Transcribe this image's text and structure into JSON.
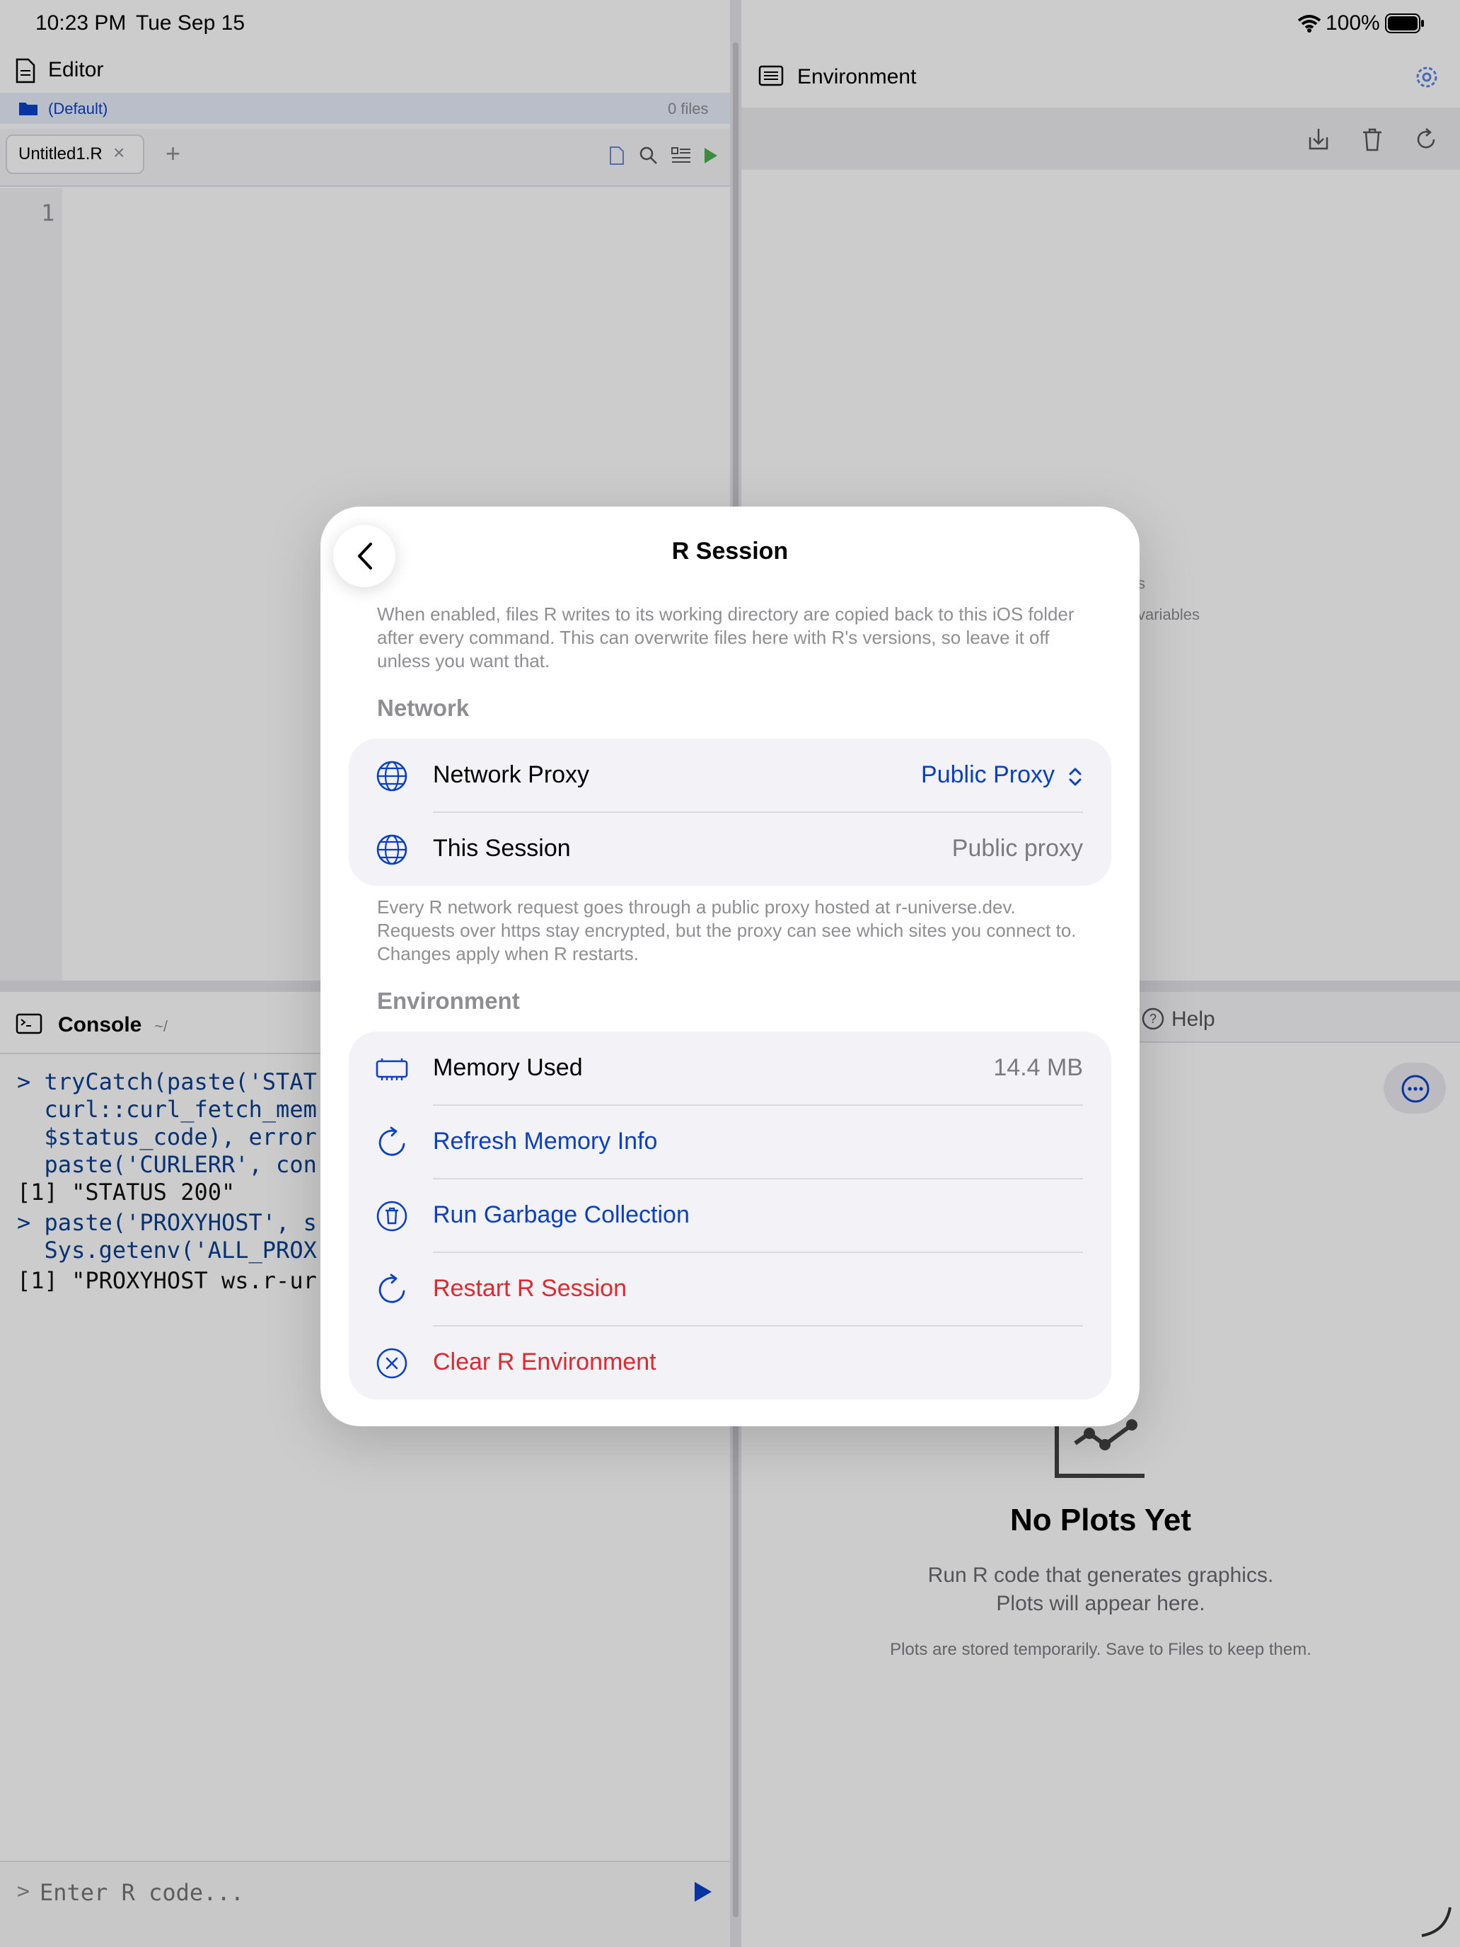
{
  "status_bar": {
    "time": "10:23 PM",
    "date": "Tue Sep 15",
    "battery": "100%"
  },
  "editor": {
    "title": "Editor",
    "folder": "(Default)",
    "file_count": "0 files",
    "tab": "Untitled1.R",
    "line_number": "1"
  },
  "environment": {
    "title": "Environment",
    "empty_partial_1": "s",
    "empty_partial_2": "variables"
  },
  "console": {
    "title": "Console",
    "path": "~/",
    "lines": [
      "> tryCatch(paste('STAT",
      "  curl::curl_fetch_mem",
      "  $status_code), error",
      "  paste('CURLERR', con",
      "[1] \"STATUS 200\"",
      "> paste('PROXYHOST', s",
      "  Sys.getenv('ALL_PROX",
      "[1] \"PROXYHOST ws.r-ur"
    ],
    "input_prompt": ">",
    "input_placeholder": "Enter R code..."
  },
  "help": {
    "title": "Help"
  },
  "plots": {
    "empty_title": "No Plots Yet",
    "empty_line1": "Run R code that generates graphics.",
    "empty_line2": "Plots will appear here.",
    "empty_note": "Plots are stored temporarily. Save to Files to keep them."
  },
  "modal": {
    "title": "R Session",
    "sync_footnote": "When enabled, files R writes to its working directory are copied back to this iOS folder after every command. This can overwrite files here with R's versions, so leave it off unless you want that.",
    "network_header": "Network",
    "network_proxy_label": "Network Proxy",
    "network_proxy_value": "Public Proxy",
    "this_session_label": "This Session",
    "this_session_value": "Public proxy",
    "network_footnote": "Every R network request goes through a public proxy hosted at r-universe.dev. Requests over https stay encrypted, but the proxy can see which sites you connect to. Changes apply when R restarts.",
    "environment_header": "Environment",
    "memory_label": "Memory Used",
    "memory_value": "14.4 MB",
    "refresh_label": "Refresh Memory Info",
    "gc_label": "Run Garbage Collection",
    "restart_label": "Restart R Session",
    "clear_label": "Clear R Environment"
  },
  "colors": {
    "accent": "#0a40c9",
    "destructive": "#e0282e",
    "secondary": "#8e8e93"
  }
}
